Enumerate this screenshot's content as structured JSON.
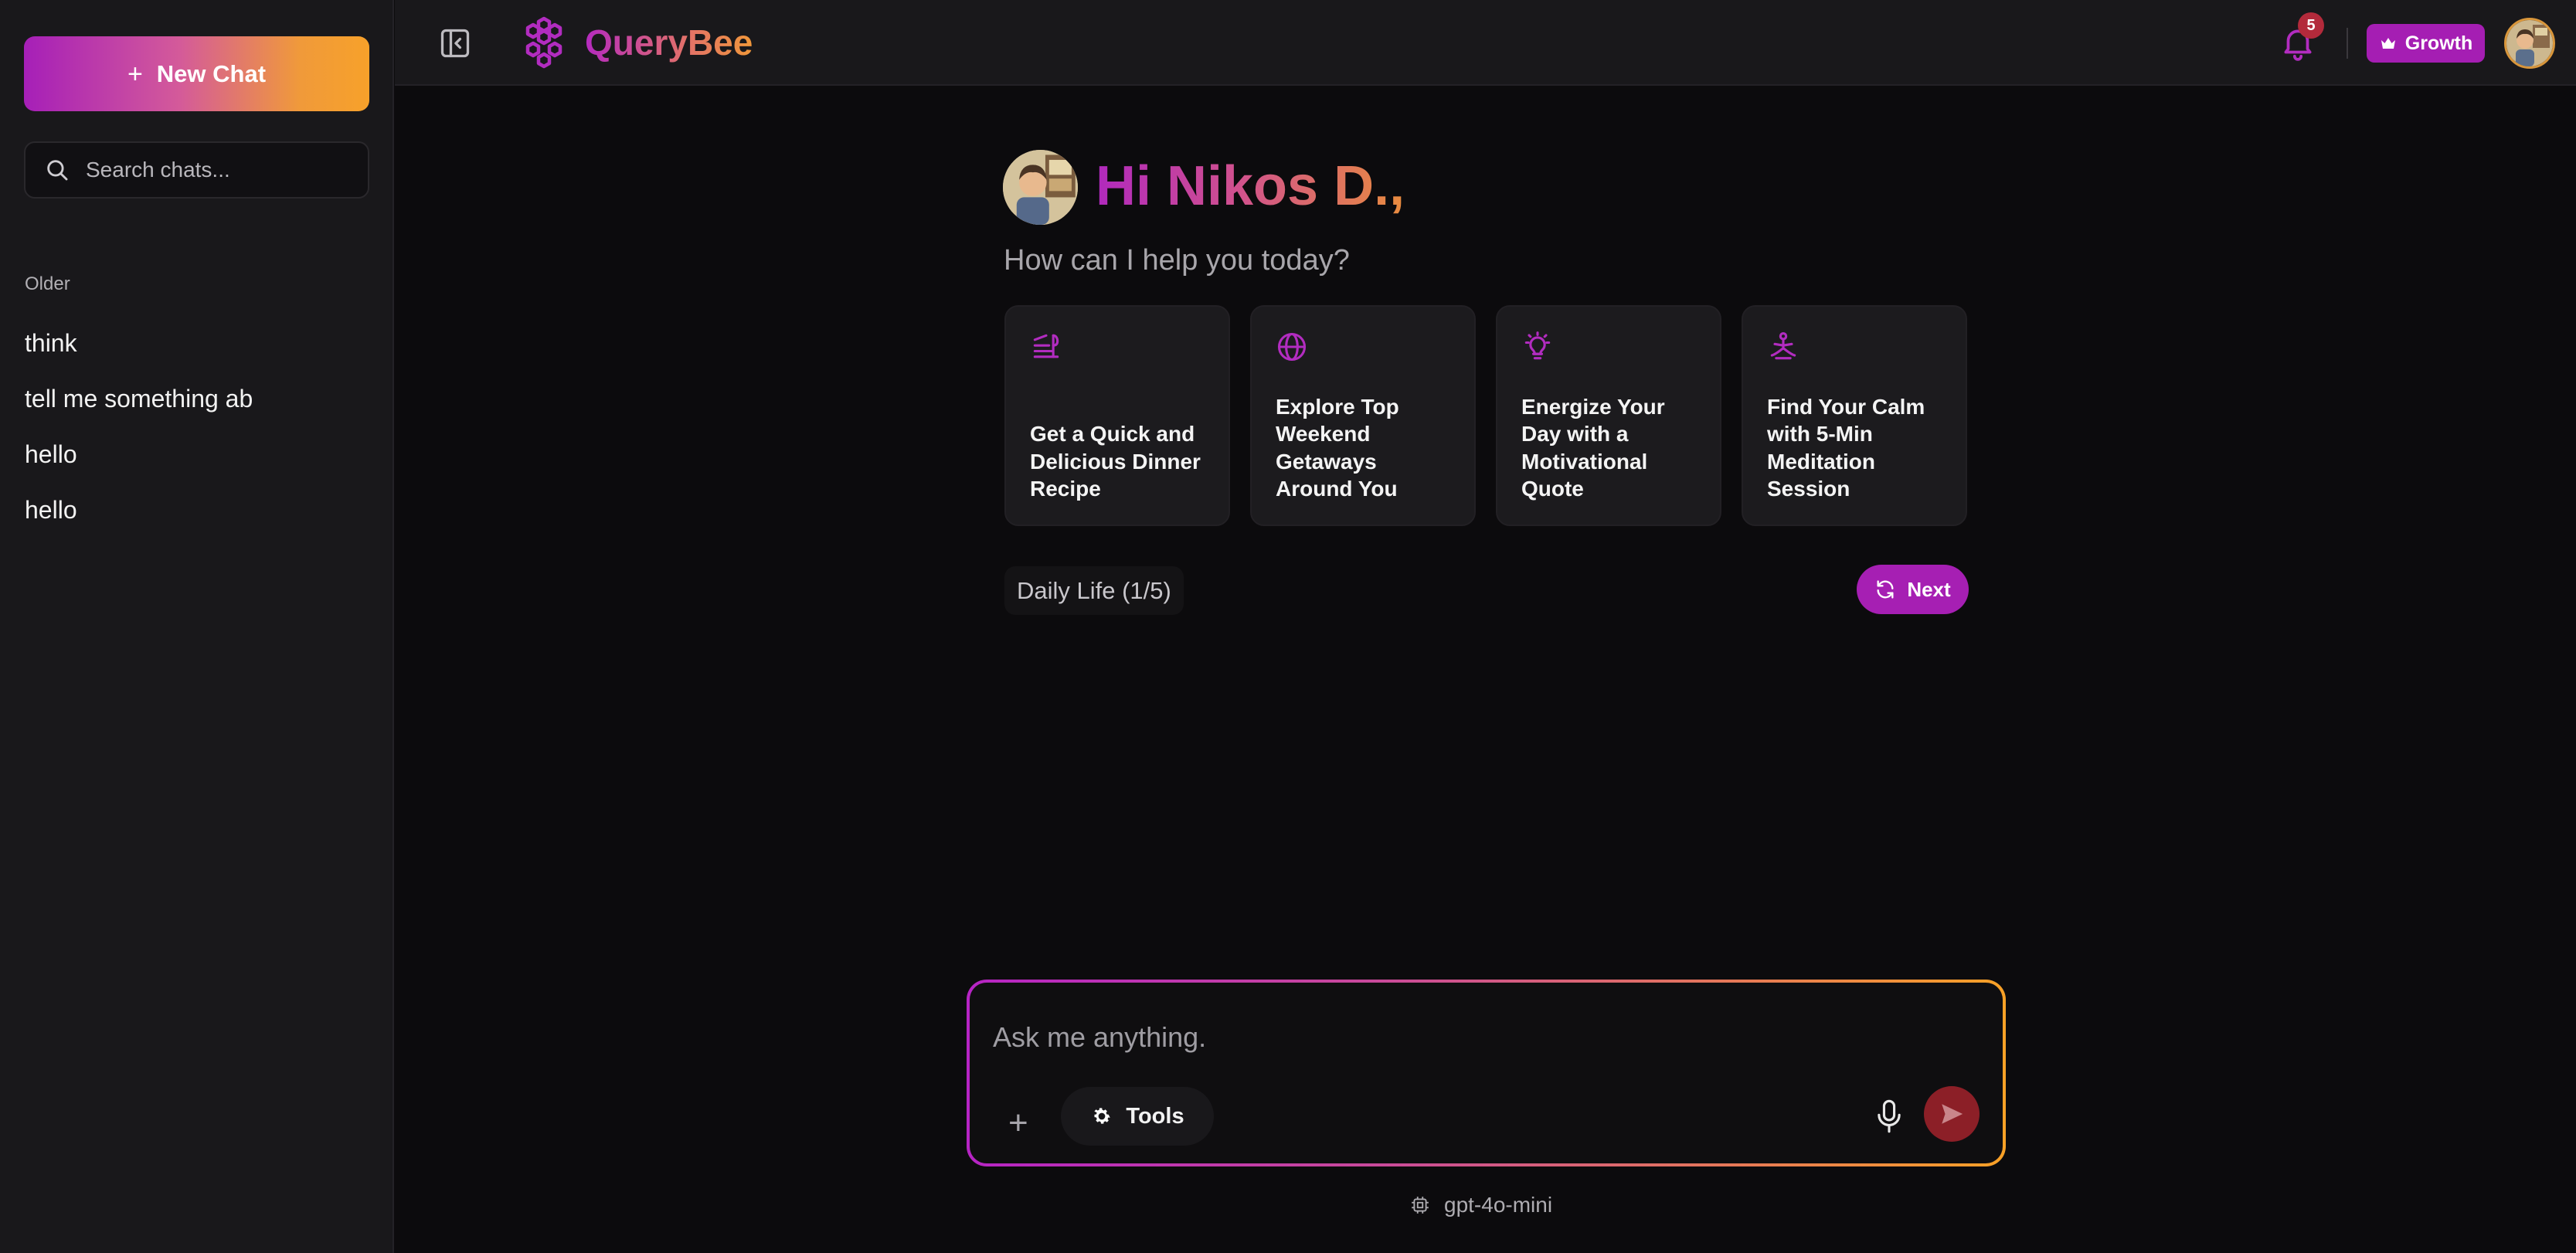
{
  "sidebar": {
    "new_chat_label": "New Chat",
    "search_placeholder": "Search chats...",
    "section_label": "Older",
    "chats": [
      {
        "label": "think"
      },
      {
        "label": "tell me something ab"
      },
      {
        "label": "hello"
      },
      {
        "label": "hello"
      }
    ]
  },
  "header": {
    "app_name": "QueryBee",
    "notification_count": "5",
    "plan_label": "Growth"
  },
  "main": {
    "greeting": "Hi Nikos D.,",
    "subtitle": "How can I help you today?",
    "suggestions": [
      {
        "icon": "dinner-icon",
        "text": "Get a Quick and Delicious Dinner Recipe"
      },
      {
        "icon": "globe-icon",
        "text": "Explore Top Weekend Getaways Around You"
      },
      {
        "icon": "lightbulb-icon",
        "text": "Energize Your Day with a Motivational Quote"
      },
      {
        "icon": "meditation-icon",
        "text": "Find Your Calm with 5-Min Meditation Session"
      }
    ],
    "category_label": "Daily Life (1/5)",
    "next_label": "Next"
  },
  "composer": {
    "placeholder": "Ask me anything.",
    "tools_label": "Tools"
  },
  "footer": {
    "model_name": "gpt-4o-mini"
  },
  "colors": {
    "accent_purple": "#a61fb3",
    "accent_orange": "#f7a12a",
    "send_button": "#8c1f27",
    "notification_badge": "#b32a3b"
  }
}
